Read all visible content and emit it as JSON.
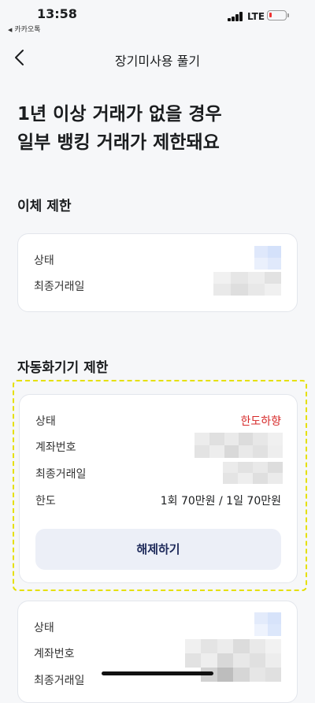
{
  "status_bar": {
    "time": "13:58",
    "back_app": "카카오톡",
    "network": "LTE"
  },
  "nav": {
    "title": "장기미사용 풀기"
  },
  "headline": {
    "line1": "1년 이상 거래가 없을 경우",
    "line2": "일부 뱅킹 거래가 제한돼요"
  },
  "transfer": {
    "title": "이체 제한",
    "rows": [
      {
        "label": "상태"
      },
      {
        "label": "최종거래일"
      }
    ]
  },
  "atm": {
    "title": "자동화기기 제한",
    "rows": [
      {
        "label": "상태",
        "value": "한도하향"
      },
      {
        "label": "계좌번호"
      },
      {
        "label": "최종거래일"
      },
      {
        "label": "한도",
        "value": "1회 70만원 / 1일 70만원"
      }
    ],
    "release_button": "해제하기"
  },
  "card3": {
    "rows": [
      {
        "label": "상태"
      },
      {
        "label": "계좌번호"
      },
      {
        "label": "최종거래일"
      }
    ]
  },
  "colors": {
    "accent_red": "#d62828",
    "highlight": "#e5e000",
    "button_bg": "#eceff7"
  }
}
